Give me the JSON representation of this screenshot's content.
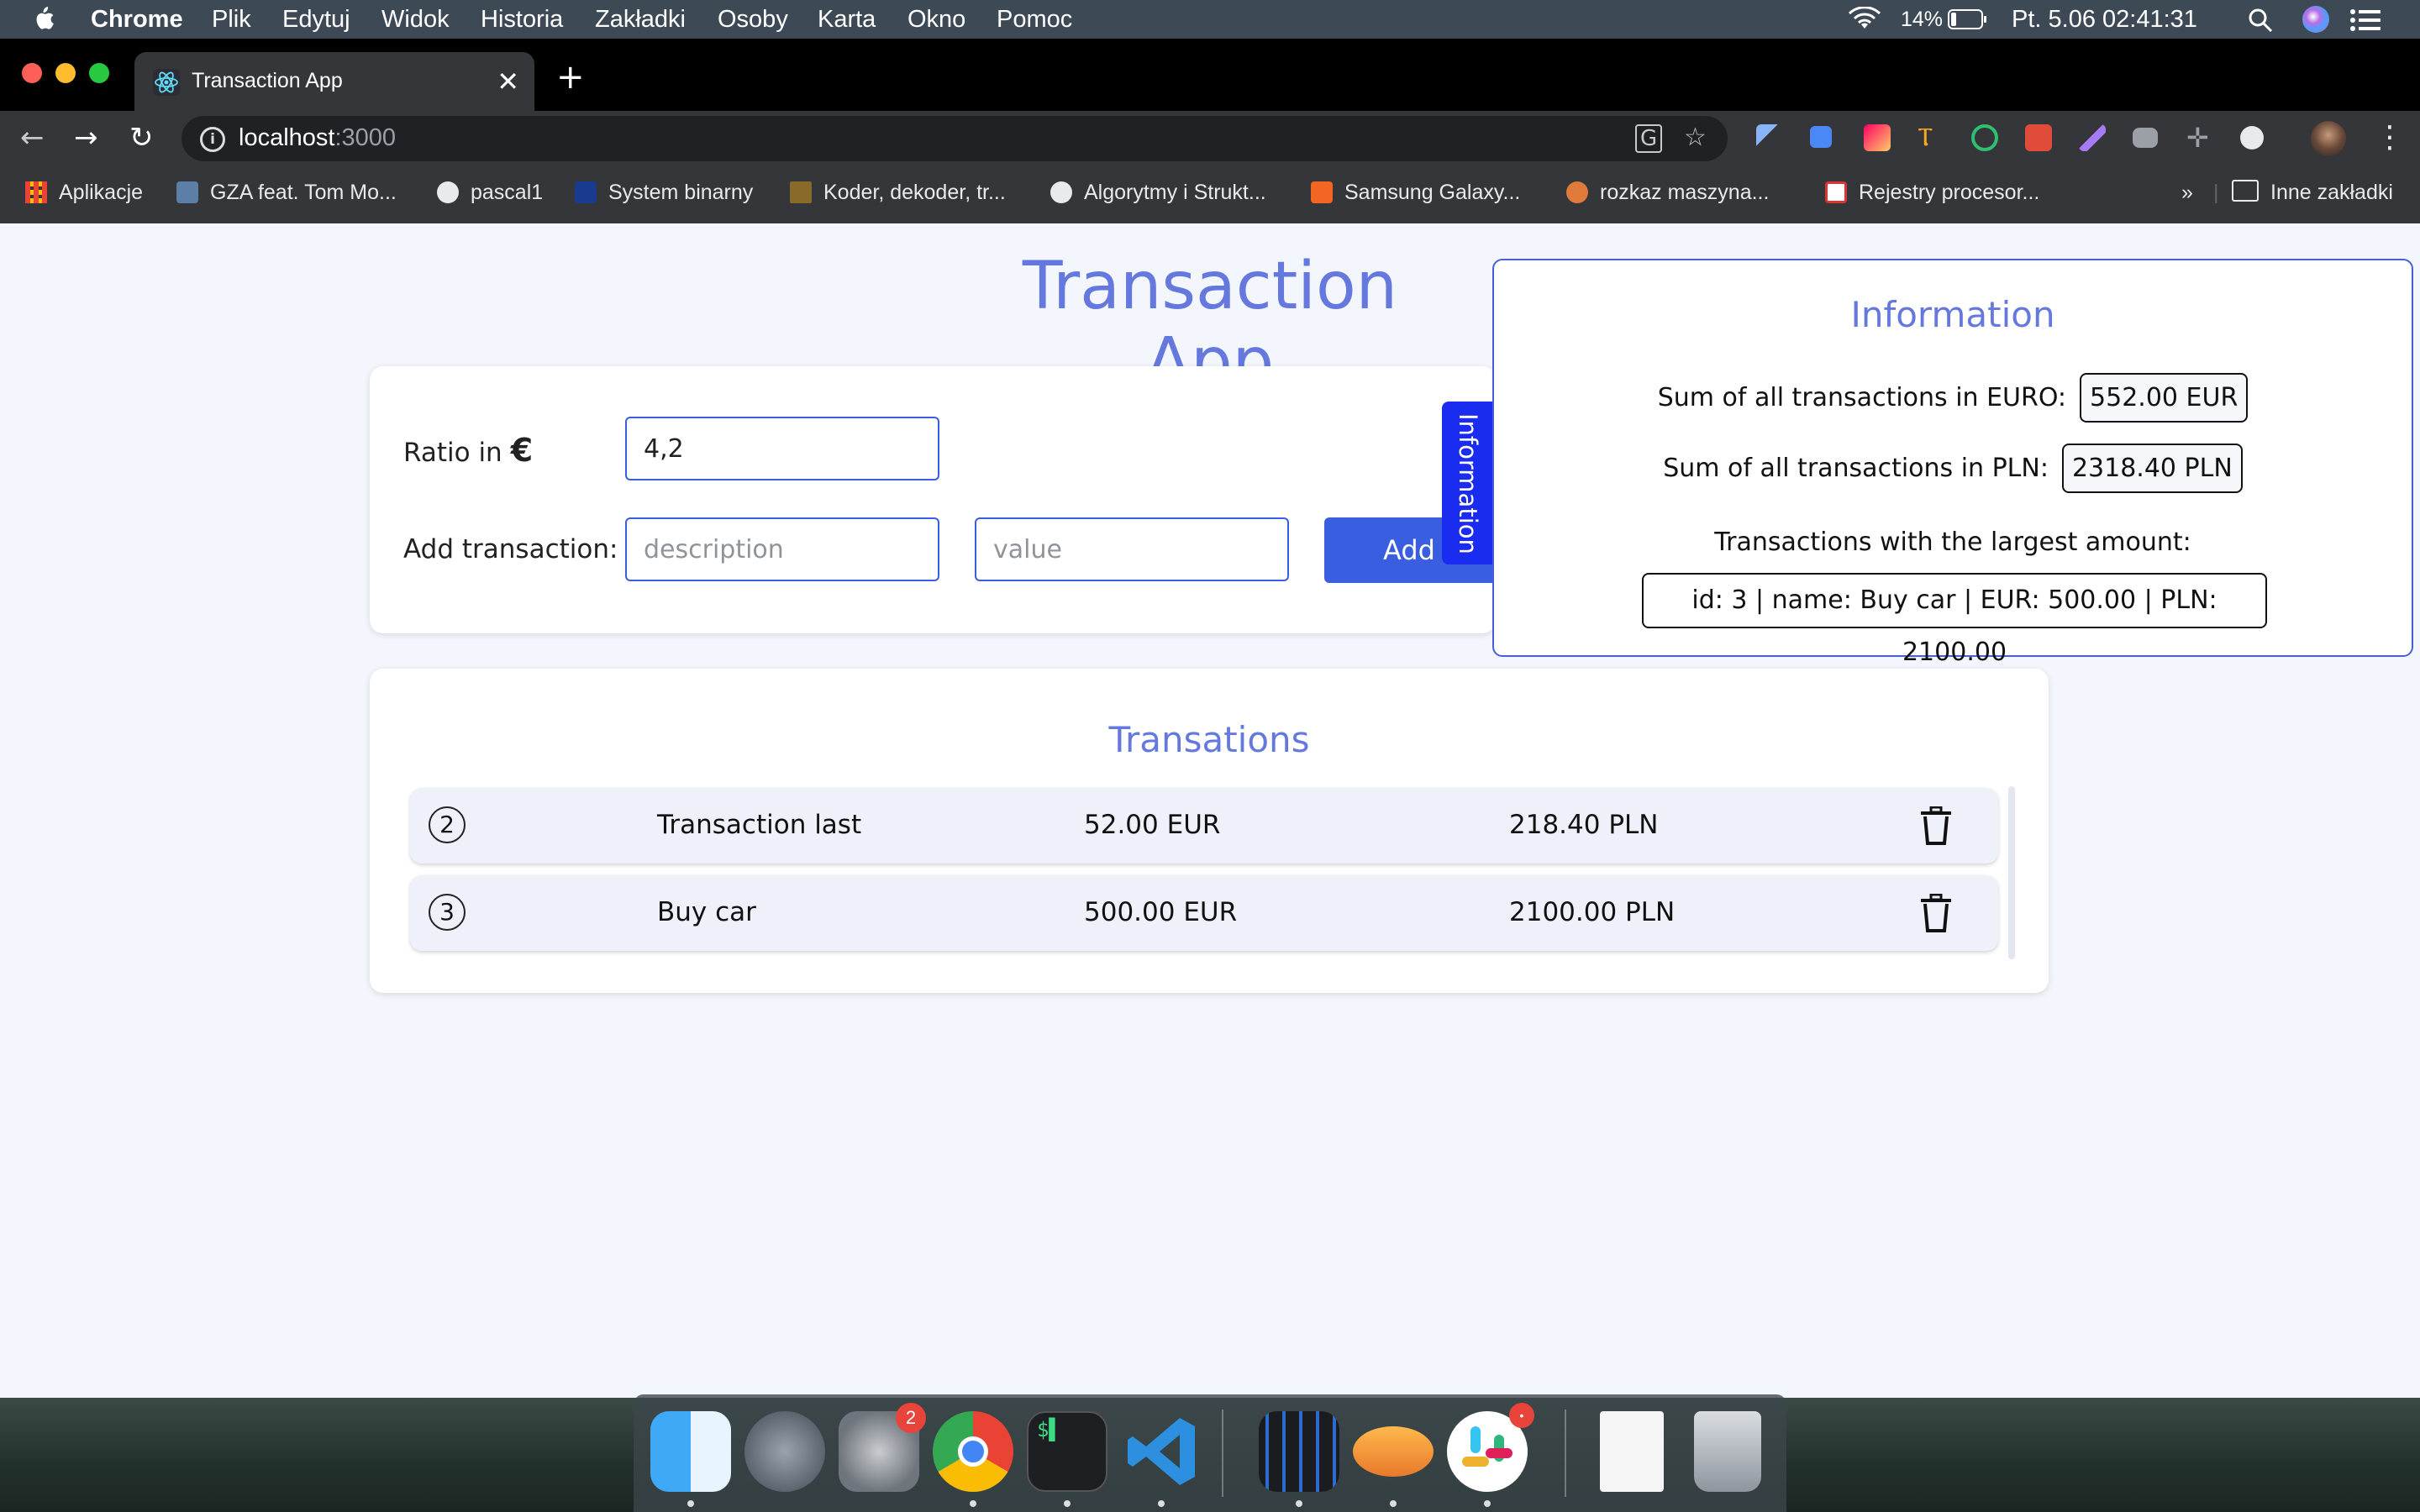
{
  "menubar": {
    "app_name": "Chrome",
    "menus": [
      "Plik",
      "Edytuj",
      "Widok",
      "Historia",
      "Zakładki",
      "Osoby",
      "Karta",
      "Okno",
      "Pomoc"
    ],
    "battery": "14%",
    "datetime": "Pt. 5.06  02:41:31"
  },
  "browser": {
    "tab_title": "Transaction App",
    "url_host": "localhost",
    "url_port": ":3000",
    "bookmarks": [
      "Aplikacje",
      "GZA feat. Tom Mo...",
      "pascal1",
      "System binarny",
      "Koder, dekoder, tr...",
      "Algorytmy i Strukt...",
      "Samsung Galaxy...",
      "rozkaz maszyna...",
      "Rejestry procesor...",
      "»",
      "Inne zakładki"
    ]
  },
  "app": {
    "title": "Transaction App",
    "form": {
      "ratio_label": "Ratio in",
      "ratio_symbol": "€",
      "ratio_value": "4,2",
      "add_label": "Add transaction:",
      "description_placeholder": "description",
      "value_placeholder": "value",
      "add_button": "Add"
    },
    "info_tab_label": "Information",
    "info_panel": {
      "heading": "Information",
      "sum_euro_label": "Sum of all transactions in EURO:",
      "sum_euro_value": "552.00 EUR",
      "sum_pln_label": "Sum of all transactions in PLN:",
      "sum_pln_value": "2318.40 PLN",
      "largest_label": "Transactions with the largest amount:",
      "largest_value": "id: 3 | name: Buy car | EUR: 500.00 | PLN: 2100.00"
    },
    "list": {
      "title": "Transations",
      "rows": [
        {
          "id": "2",
          "name": "Transaction last",
          "eur": "52.00 EUR",
          "pln": "218.40 PLN"
        },
        {
          "id": "3",
          "name": "Buy car",
          "eur": "500.00 EUR",
          "pln": "2100.00 PLN"
        }
      ]
    },
    "colors": {
      "accent": "#3a5ee0",
      "title": "#6578de",
      "info_tab": "#1a2cf0"
    }
  },
  "dock": {
    "apps": [
      "finder-icon",
      "launchpad-icon",
      "system-preferences-icon",
      "chrome-icon",
      "terminal-icon",
      "vscode-icon",
      "activity-monitor-icon",
      "transmit-icon",
      "slack-icon",
      "document-icon",
      "trash-icon"
    ],
    "system_preferences_badge": "2"
  }
}
